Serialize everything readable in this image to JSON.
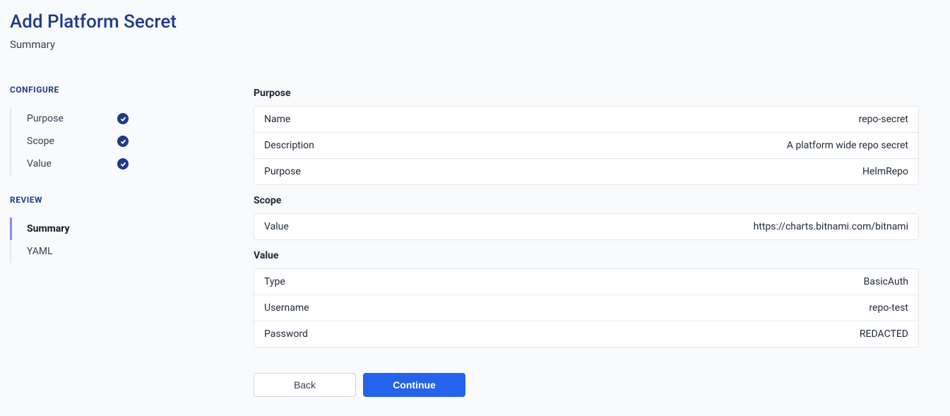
{
  "header": {
    "title": "Add Platform Secret",
    "subtitle": "Summary"
  },
  "sidebar": {
    "configure_label": "CONFIGURE",
    "review_label": "REVIEW",
    "configure_steps": [
      {
        "label": "Purpose",
        "checked": true
      },
      {
        "label": "Scope",
        "checked": true
      },
      {
        "label": "Value",
        "checked": true
      }
    ],
    "review_steps": [
      {
        "label": "Summary",
        "active": true
      },
      {
        "label": "YAML",
        "active": false
      }
    ]
  },
  "summary": {
    "groups": [
      {
        "title": "Purpose",
        "rows": [
          {
            "key": "Name",
            "value": "repo-secret"
          },
          {
            "key": "Description",
            "value": "A platform wide repo secret"
          },
          {
            "key": "Purpose",
            "value": "HelmRepo"
          }
        ]
      },
      {
        "title": "Scope",
        "rows": [
          {
            "key": "Value",
            "value": "https://charts.bitnami.com/bitnami"
          }
        ]
      },
      {
        "title": "Value",
        "rows": [
          {
            "key": "Type",
            "value": "BasicAuth"
          },
          {
            "key": "Username",
            "value": "repo-test"
          },
          {
            "key": "Password",
            "value": "REDACTED"
          }
        ]
      }
    ]
  },
  "buttons": {
    "back": "Back",
    "continue": "Continue"
  }
}
